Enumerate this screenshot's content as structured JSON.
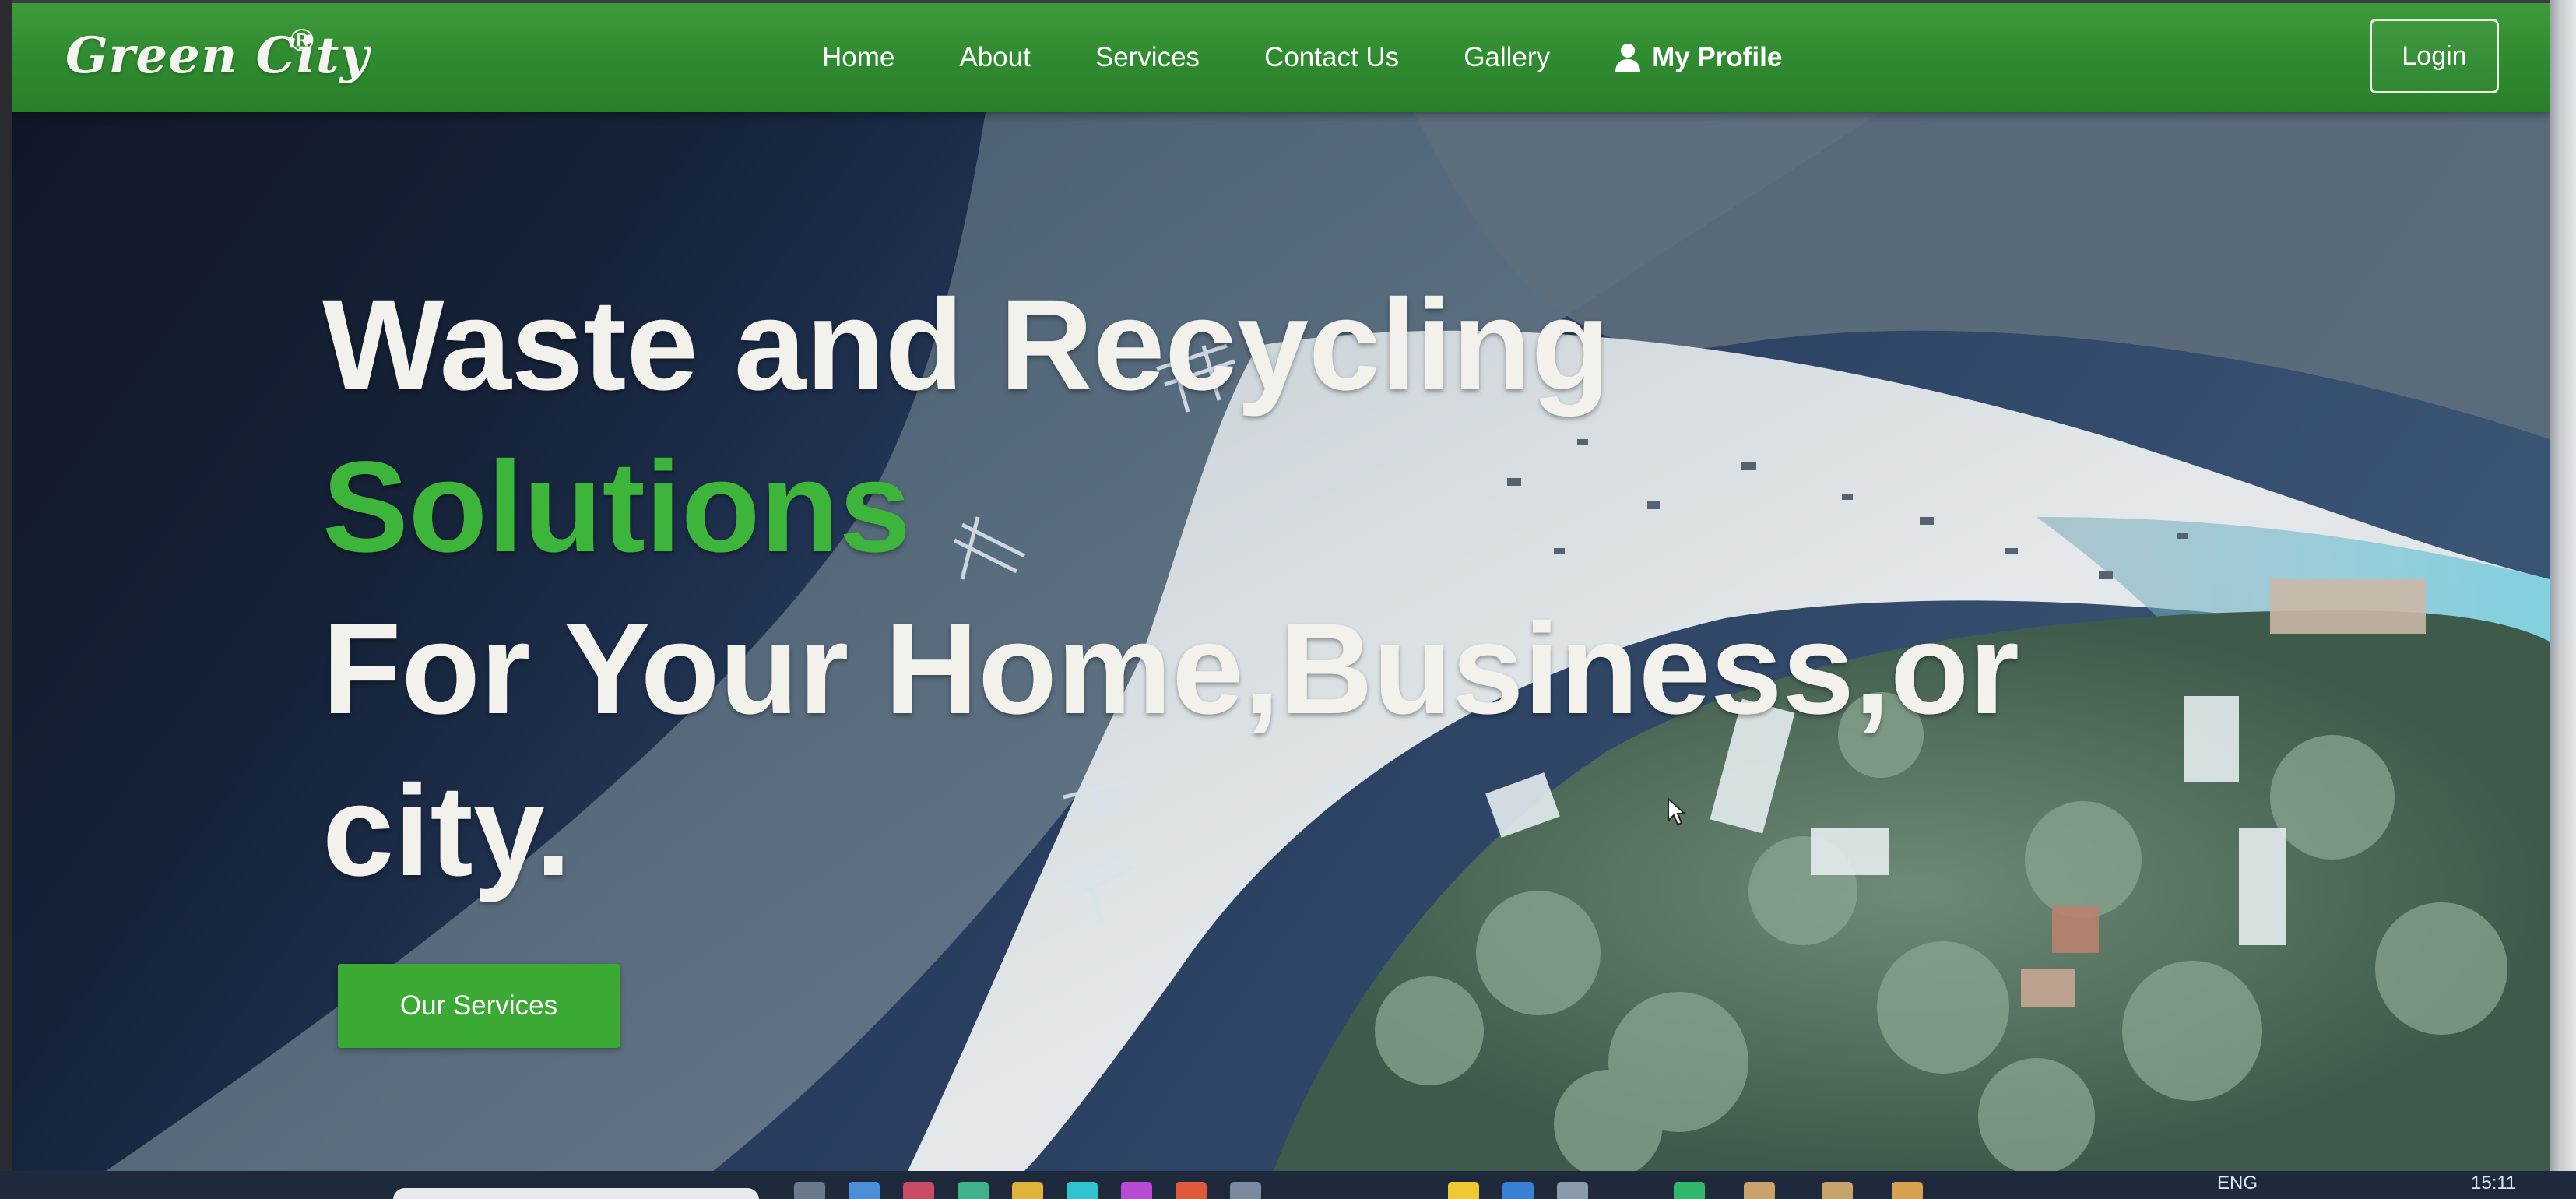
{
  "brand": {
    "name": "Green City",
    "registered": "®"
  },
  "nav": {
    "items": [
      {
        "label": "Home"
      },
      {
        "label": "About"
      },
      {
        "label": "Services"
      },
      {
        "label": "Contact Us"
      },
      {
        "label": "Gallery"
      }
    ],
    "profile_label": "My Profile",
    "login_label": "Login"
  },
  "hero": {
    "line1": "Waste and Recycling",
    "line2": "Solutions",
    "line3": "For Your Home,Business,or",
    "line4": "city.",
    "cta_label": "Our Services"
  },
  "taskbar": {
    "language": "ENG",
    "time": "15:11"
  },
  "colors": {
    "nav_green": "#2e8a2f",
    "accent_green": "#3db53a",
    "cta_green": "#3aaa35",
    "hero_text": "#f3f1ec"
  },
  "icons": [
    "user-icon",
    "mouse-cursor-icon"
  ]
}
